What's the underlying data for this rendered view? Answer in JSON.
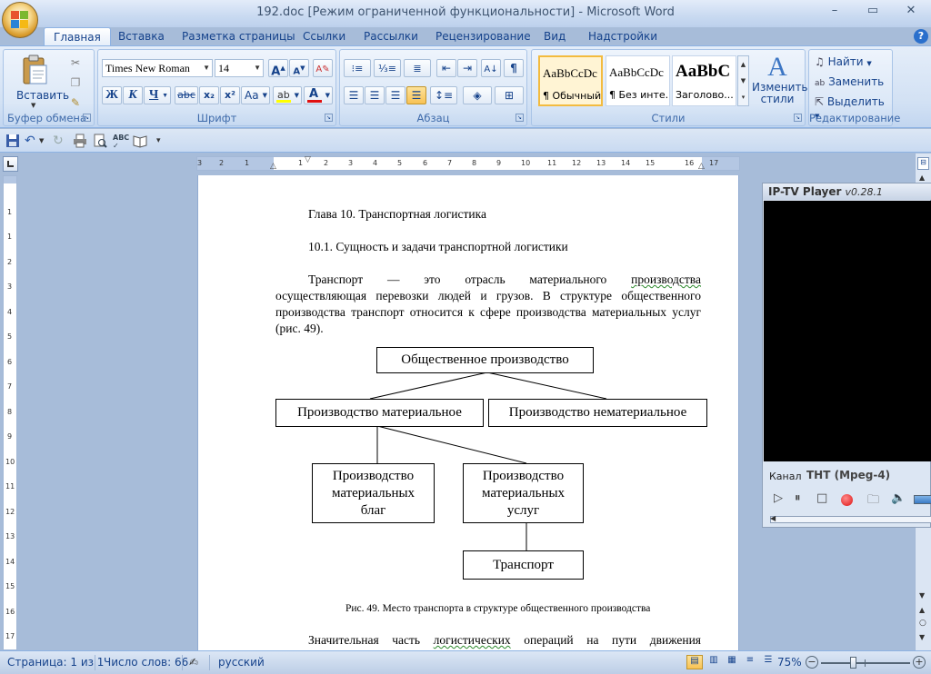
{
  "window": {
    "title": "192.doc [Режим ограниченной функциональности] - Microsoft Word",
    "controls": [
      "–",
      "▭",
      "✕"
    ]
  },
  "tabs": [
    "Главная",
    "Вставка",
    "Разметка страницы",
    "Ссылки",
    "Рассылки",
    "Рецензирование",
    "Вид",
    "Надстройки"
  ],
  "ribbon": {
    "clipboard": {
      "label": "Буфер обмена",
      "paste": "Вставить"
    },
    "font": {
      "label": "Шрифт",
      "font_name": "Times New Roman",
      "font_size": "14",
      "grow": "A",
      "shrink": "A",
      "bold": "Ж",
      "italic": "К",
      "underline": "Ч",
      "strike": "abc",
      "subscript": "x₂",
      "superscript": "x²",
      "change_case": "Aa",
      "highlight_color": "#ffff00",
      "font_color": "#e01010"
    },
    "paragraph": {
      "label": "Абзац"
    },
    "styles": {
      "label": "Стили",
      "items": [
        {
          "preview": "AaBbCcDc",
          "name": "¶ Обычный"
        },
        {
          "preview": "AaBbCcDc",
          "name": "¶ Без инте..."
        },
        {
          "preview": "AaBbC",
          "name": "Заголово..."
        }
      ],
      "change_styles": "Изменить стили"
    },
    "editing": {
      "label": "Редактирование",
      "find": "Найти",
      "replace": "Заменить",
      "select": "Выделить"
    }
  },
  "ruler": {
    "h_labels": [
      "3",
      "2",
      "1",
      "1",
      "2",
      "3",
      "4",
      "5",
      "6",
      "7",
      "8",
      "9",
      "10",
      "11",
      "12",
      "13",
      "14",
      "15",
      "16",
      "17"
    ],
    "v_labels": [
      "1",
      "1",
      "2",
      "3",
      "4",
      "5",
      "6",
      "7",
      "8",
      "9",
      "10",
      "11",
      "12",
      "13",
      "14",
      "15",
      "16",
      "17"
    ]
  },
  "document": {
    "chapter": "Глава  10. Транспортная логистика",
    "section": "10.1. Сущность и задачи транспортной логистики",
    "para1_lines": [
      "Транспорт — это отрасль материального производства",
      "осуществляющая перевозки людей и грузов. В структуре общественного",
      "производства транспорт относится к сфере производства материальных услуг",
      "(рис. 49)."
    ],
    "diagram": {
      "root": "Общественное производство",
      "left": "Производство материальное",
      "right": "Производство нематериальное",
      "goods": [
        "Производство",
        "материальных",
        "благ"
      ],
      "services": [
        "Производство",
        "материальных",
        "услуг"
      ],
      "transport": "Транспорт"
    },
    "caption": "Рис. 49. Место транспорта в структуре общественного производства",
    "para2_line": "Значительная часть логистических операций на пути движения"
  },
  "iptv": {
    "title": "IP-TV Player",
    "version": "v0.28.1",
    "channel_label": "Канал",
    "channel": "ТНТ (Mpeg-4)"
  },
  "status": {
    "page": "Страница: 1 из 1",
    "words": "Число слов: 66",
    "language": "русский",
    "zoom": "75%",
    "zoom_level": 0.75
  }
}
